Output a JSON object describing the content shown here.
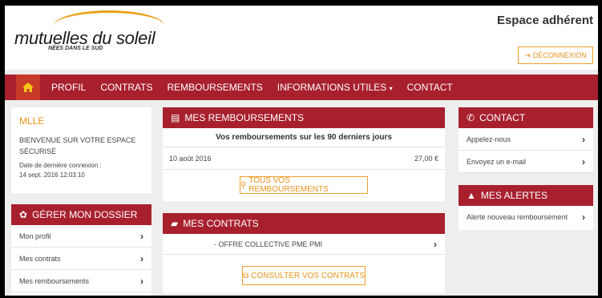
{
  "header": {
    "brand": "mutuelles du soleil",
    "tagline": "NÉES DANS LE SUD",
    "espace_title": "Espace adhérent",
    "logout_label": "DÉCONNEXION"
  },
  "nav": {
    "items": [
      "PROFIL",
      "CONTRATS",
      "REMBOURSEMENTS",
      "INFORMATIONS UTILES",
      "CONTACT"
    ]
  },
  "user": {
    "name": "MLLE",
    "welcome": "BIENVENUE SUR VOTRE ESPACE SÉCURISÉ",
    "last_conn_label": "Date de dernière connexion :",
    "last_conn_value": "14 sept. 2016 12:03:10"
  },
  "dossier": {
    "title": "GÉRER MON DOSSIER",
    "items": [
      "Mon profil",
      "Mes contrats",
      "Mes remboursements"
    ]
  },
  "remboursements": {
    "title": "MES REMBOURSEMENTS",
    "subtitle": "Vos remboursements sur les 90 derniers jours",
    "row_date": "10 août 2016",
    "row_amount": "27,00 €",
    "button": "TOUS VOS REMBOURSEMENTS"
  },
  "contrats": {
    "title": "MES CONTRATS",
    "row": "- OFFRE COLLECTIVE PME PMI",
    "button": "CONSULTER VOS CONTRATS"
  },
  "contact": {
    "title": "CONTACT",
    "items": [
      "Appelez-nous",
      "Envoyez un e-mail"
    ]
  },
  "alertes": {
    "title": "MES ALERTES",
    "items": [
      "Alerte nouveau remboursement"
    ]
  },
  "colors": {
    "primary": "#a8202e",
    "accent": "#e8941d",
    "home": "#c83a28"
  }
}
